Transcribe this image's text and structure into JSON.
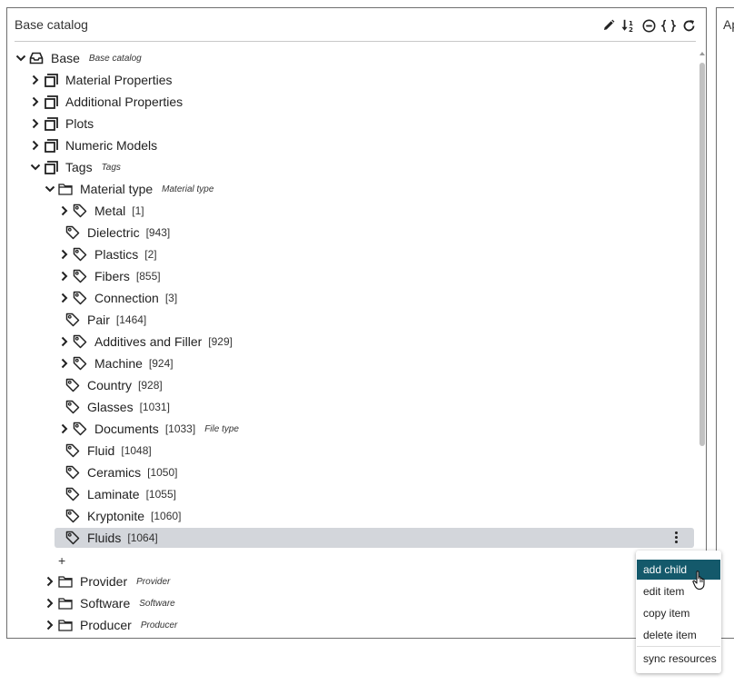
{
  "panel": {
    "title": "Base catalog",
    "right_panel_title": "Ap"
  },
  "toolbar": {
    "icons": [
      "pencil-icon",
      "sort-numeric-icon",
      "collapse-circle-icon",
      "braces-icon",
      "refresh-icon"
    ]
  },
  "tree": {
    "root": {
      "label": "Base",
      "sublabel": "Base catalog"
    },
    "level1": [
      {
        "label": "Material Properties"
      },
      {
        "label": "Additional Properties"
      },
      {
        "label": "Plots"
      },
      {
        "label": "Numeric Models"
      },
      {
        "label": "Tags",
        "sublabel": "Tags"
      }
    ],
    "material_type": {
      "label": "Material type",
      "sublabel": "Material type"
    },
    "tags": [
      {
        "label": "Metal",
        "count": "[1]"
      },
      {
        "label": "Dielectric",
        "count": "[943]"
      },
      {
        "label": "Plastics",
        "count": "[2]"
      },
      {
        "label": "Fibers",
        "count": "[855]"
      },
      {
        "label": "Connection",
        "count": "[3]"
      },
      {
        "label": "Pair",
        "count": "[1464]"
      },
      {
        "label": "Additives and Filler",
        "count": "[929]"
      },
      {
        "label": "Machine",
        "count": "[924]"
      },
      {
        "label": "Country",
        "count": "[928]"
      },
      {
        "label": "Glasses",
        "count": "[1031]"
      },
      {
        "label": "Documents",
        "count": "[1033]",
        "sublabel": "File type"
      },
      {
        "label": "Fluid",
        "count": "[1048]"
      },
      {
        "label": "Ceramics",
        "count": "[1050]"
      },
      {
        "label": "Laminate",
        "count": "[1055]"
      },
      {
        "label": "Kryptonite",
        "count": "[1060]"
      },
      {
        "label": "Fluids",
        "count": "[1064]"
      }
    ],
    "add_label": "+",
    "folders": [
      {
        "label": "Provider",
        "sublabel": "Provider"
      },
      {
        "label": "Software",
        "sublabel": "Software"
      },
      {
        "label": "Producer",
        "sublabel": "Producer"
      }
    ]
  },
  "context_menu": {
    "items": [
      "add child",
      "edit item",
      "copy item",
      "delete item",
      "sync resources"
    ]
  },
  "colors": {
    "selected_row": "#d3d6db",
    "menu_active": "#14596b"
  }
}
